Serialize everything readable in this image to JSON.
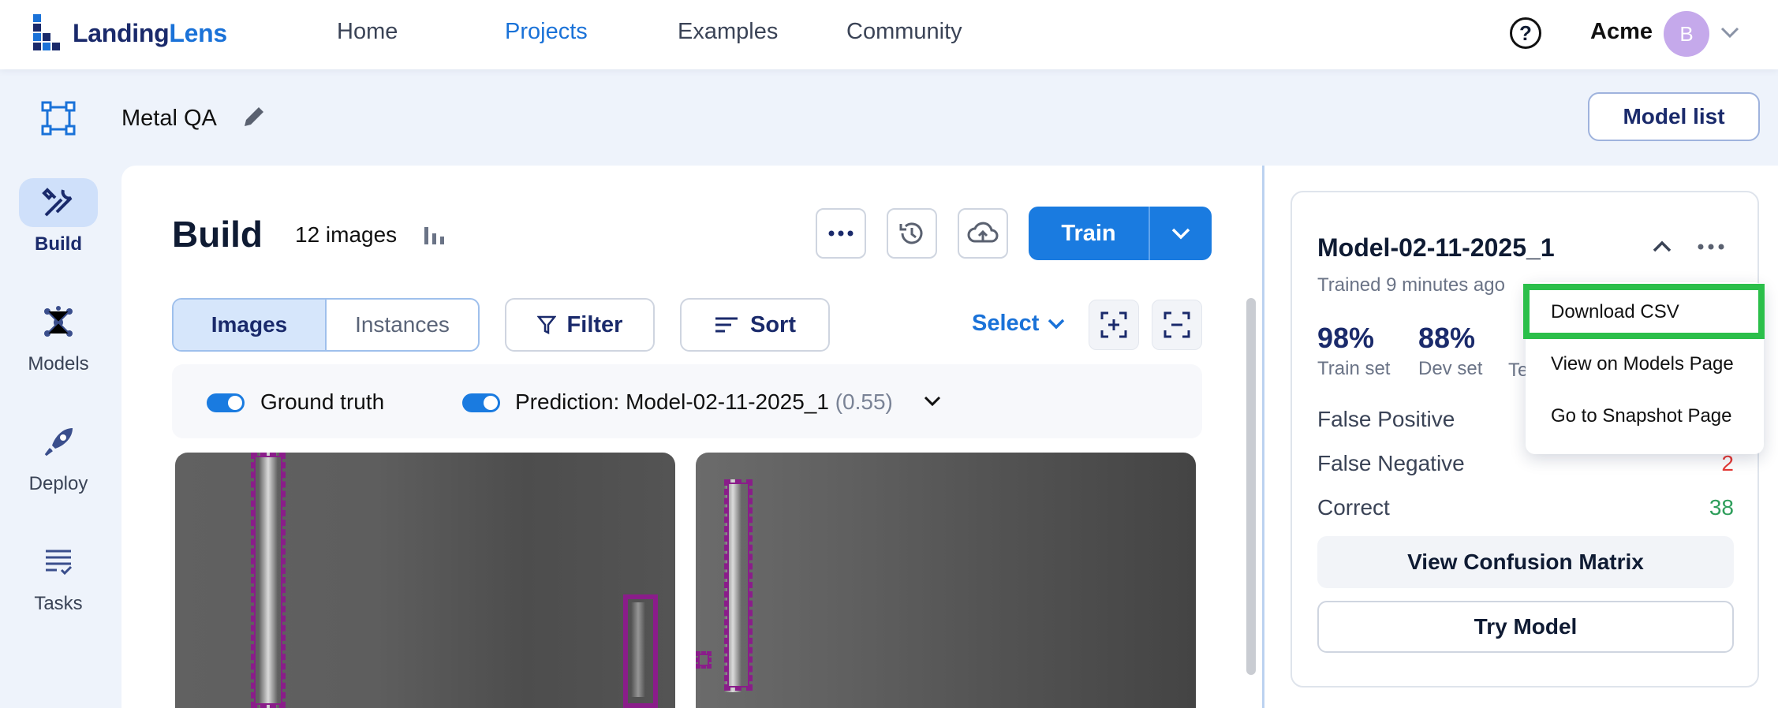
{
  "brand": {
    "name_part1": "Landing",
    "name_part2": "Lens"
  },
  "nav": {
    "items": [
      "Home",
      "Projects",
      "Examples",
      "Community"
    ],
    "active": "Projects",
    "help_label": "?",
    "org": "Acme",
    "avatar_initial": "B"
  },
  "project": {
    "name": "Metal QA",
    "model_list_label": "Model list"
  },
  "sidebar": {
    "items": [
      {
        "label": "Build",
        "icon": "build-icon"
      },
      {
        "label": "Models",
        "icon": "models-icon"
      },
      {
        "label": "Deploy",
        "icon": "deploy-icon"
      },
      {
        "label": "Tasks",
        "icon": "tasks-icon"
      }
    ],
    "active": "Build"
  },
  "build": {
    "title": "Build",
    "count": "12 images",
    "train_label": "Train",
    "tabs": [
      "Images",
      "Instances"
    ],
    "active_tab": "Images",
    "filter_label": "Filter",
    "sort_label": "Sort",
    "select_label": "Select",
    "legend": {
      "ground_truth": "Ground truth",
      "prediction": "Prediction: Model-02-11-2025_1",
      "prediction_score": "(0.55)"
    }
  },
  "model_card": {
    "name": "Model-02-11-2025_1",
    "trained": "Trained 9 minutes ago",
    "stats": [
      {
        "value": "98%",
        "label": "Train set"
      },
      {
        "value": "88%",
        "label": "Dev set"
      },
      {
        "value": "",
        "label": "Te"
      }
    ],
    "rows": [
      {
        "label": "False Positive",
        "value": ""
      },
      {
        "label": "False Negative",
        "value": "2"
      },
      {
        "label": "Correct",
        "value": "38"
      }
    ],
    "confusion_label": "View Confusion Matrix",
    "try_label": "Try Model"
  },
  "menu": {
    "items": [
      "Download CSV",
      "View on Models Page",
      "Go to Snapshot Page"
    ]
  },
  "colors": {
    "accent": "#1a7be0",
    "highlight": "#2bbf4a",
    "bbox": "#8a1d8a",
    "negative": "#e53935",
    "positive": "#2e9e5b"
  }
}
